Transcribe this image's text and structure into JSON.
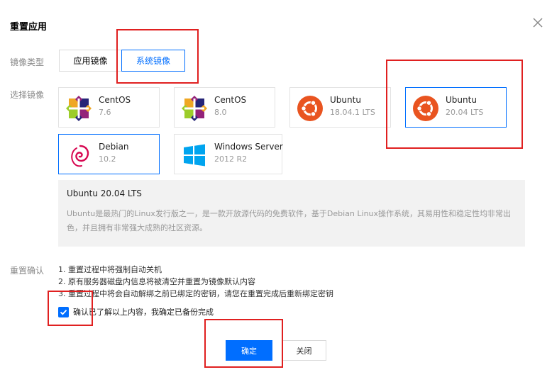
{
  "dialog": {
    "title": "重置应用"
  },
  "image_type": {
    "label": "镜像类型",
    "tabs": [
      {
        "label": "应用镜像",
        "active": false
      },
      {
        "label": "系统镜像",
        "active": true
      }
    ]
  },
  "image_select": {
    "label": "选择镜像",
    "items": [
      {
        "name": "CentOS",
        "version": "7.6",
        "icon": "centos-icon",
        "selected": false
      },
      {
        "name": "CentOS",
        "version": "8.0",
        "icon": "centos-icon",
        "selected": false
      },
      {
        "name": "Ubuntu",
        "version": "18.04.1 LTS",
        "icon": "ubuntu-icon",
        "selected": false
      },
      {
        "name": "Ubuntu",
        "version": "20.04 LTS",
        "icon": "ubuntu-icon",
        "selected": true
      },
      {
        "name": "Debian",
        "version": "10.2",
        "icon": "debian-icon",
        "selected": true
      },
      {
        "name": "Windows Server",
        "version": "2012 R2",
        "icon": "windows-icon",
        "selected": false
      }
    ]
  },
  "description": {
    "title": "Ubuntu 20.04 LTS",
    "text": "Ubuntu是最热门的Linux发行版之一，是一款开放源代码的免费软件，基于Debian Linux操作系统，其易用性和稳定性均非常出色，并且拥有非常强大成熟的社区资源。"
  },
  "confirm": {
    "label": "重置确认",
    "notes": [
      "1. 重置过程中将强制自动关机",
      "2. 原有服务器磁盘内信息将被清空并重置为镜像默认内容",
      "3. 重置过程中将会自动解绑之前已绑定的密钥，请您在重置完成后重新绑定密钥"
    ],
    "checkbox_label": "确认已了解以上内容，我确定已备份完成",
    "checked": true
  },
  "footer": {
    "ok_label": "确定",
    "close_label": "关闭"
  },
  "colors": {
    "accent": "#006eff",
    "annotation": "#e02020"
  }
}
